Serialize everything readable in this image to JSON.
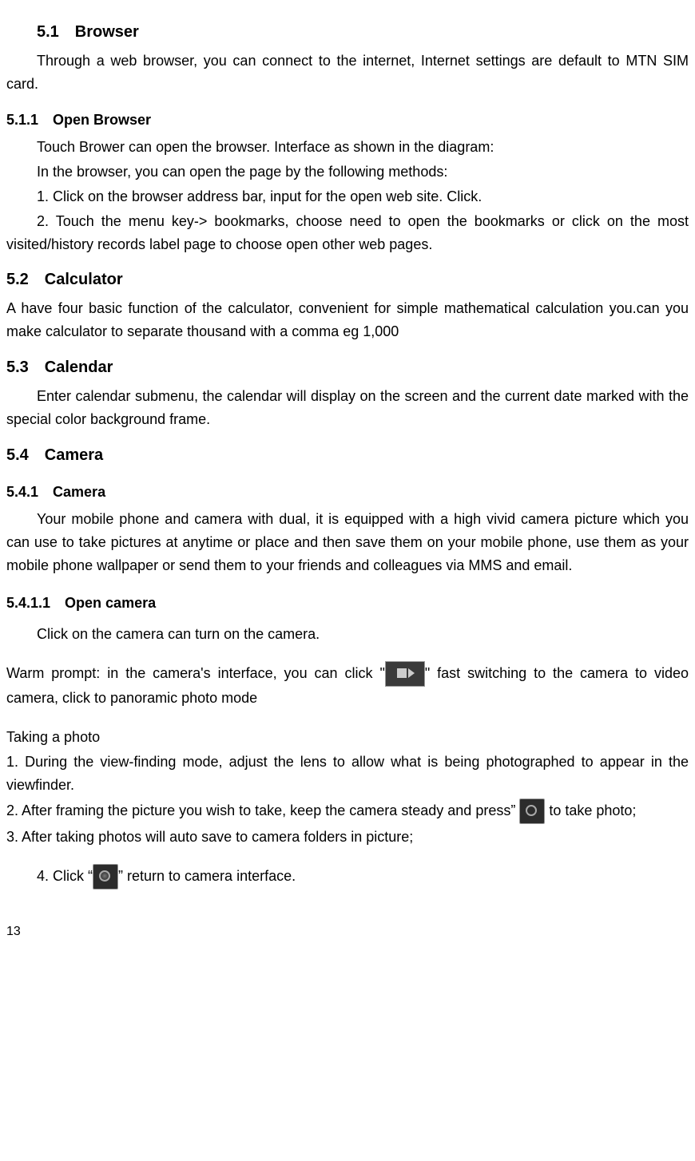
{
  "s51": {
    "heading": "5.1 Browser",
    "p1": "Through a web browser, you can connect to the internet, Internet settings are default to MTN SIM card."
  },
  "s511": {
    "heading": "5.1.1 Open Browser",
    "p1": "Touch Brower can open the browser. Interface as shown in the diagram:",
    "p2": "In the browser, you can open the page by the following methods:",
    "p3": "1. Click on the browser address bar, input for the open web site. Click.",
    "p4": "2. Touch the menu key-> bookmarks, choose need to open the bookmarks or click on the most visited/history records label page to choose open other web pages."
  },
  "s52": {
    "heading": "5.2 Calculator",
    "p1": "A have four basic function of the calculator, convenient for simple mathematical calculation you.can you make calculator to separate thousand with a comma eg 1,000"
  },
  "s53": {
    "heading": "5.3 Calendar",
    "p1": "Enter calendar submenu, the calendar will display on the screen and the current date marked with the special color background frame."
  },
  "s54": {
    "heading": "5.4 Camera"
  },
  "s541": {
    "heading": "5.4.1 Camera",
    "p1": "Your mobile phone and camera with dual, it is equipped with a high vivid camera picture which you can use to take pictures at anytime or place and then save them on your mobile phone, use them as your mobile phone wallpaper or send them to your friends and colleagues via MMS and email."
  },
  "s5411": {
    "heading": "5.4.1.1 Open camera",
    "p1": "Click on the camera can turn on the camera.",
    "warm_a": "Warm prompt: in the camera's interface, you can click \"",
    "warm_b": "\" fast switching to the camera to video camera, click to panoramic photo mode",
    "tp_heading": "Taking a photo",
    "tp1": "1. During the view-finding mode, adjust the lens to allow what is being photographed to appear in the viewfinder.",
    "tp2a": "2. After framing the picture you wish to take, keep the camera steady and press” ",
    "tp2b": " to take photo;",
    "tp3": "3. After taking photos will auto save to camera folders in picture;",
    "tp4a": "4. Click “",
    "tp4b": "” return to camera interface."
  },
  "page_number": "13"
}
